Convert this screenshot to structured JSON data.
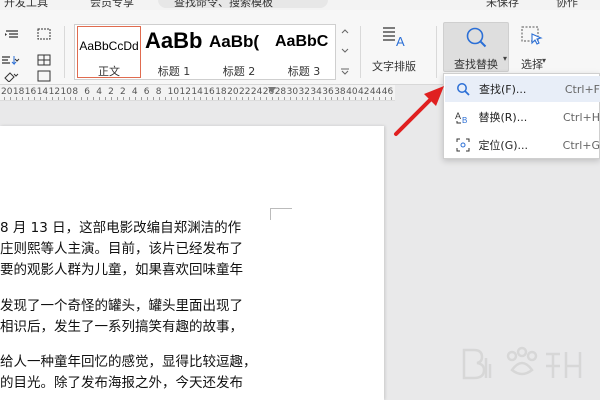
{
  "topbar": {
    "dev_tools": "开发工具",
    "member": "会员专享",
    "search_hint": "查找命令、搜索模板",
    "unsaved": "未保存",
    "collab": "协作"
  },
  "styles": [
    {
      "sample": "AaBbCcDd",
      "label": "正文"
    },
    {
      "sample": "AaBb",
      "label": "标题 1"
    },
    {
      "sample": "AaBb(",
      "label": "标题 2"
    },
    {
      "sample": "AaBbC",
      "label": "标题 3"
    }
  ],
  "ribbon": {
    "text_layout": "文字排版",
    "find_replace": "查找替换",
    "select": "选择"
  },
  "ruler_numbers": [
    "20",
    "18",
    "16",
    "14",
    "12",
    "10",
    "8",
    "6",
    "4",
    "2",
    "2",
    "4",
    "6",
    "8",
    "10",
    "12",
    "14",
    "16",
    "18",
    "20",
    "22",
    "24",
    "26",
    "28",
    "30",
    "32",
    "34",
    "36",
    "38",
    "40",
    "42",
    "44",
    "46"
  ],
  "document": {
    "p1": [
      "8 月 13 日，这部电影改编自郑渊洁的作",
      "庄则熙等人主演。目前，该片已经发布了",
      "要的观影人群为儿童，如果喜欢回味童年"
    ],
    "p2": [
      "发现了一个奇怪的罐头，罐头里面出现了",
      "相识后，发生了一系列搞笑有趣的故事，"
    ],
    "p3": [
      "给人一种童年回忆的感觉，显得比较逗趣，",
      "的目光。除了发布海报之外，今天还发布",
      "……"
    ]
  },
  "menu": [
    {
      "label": "查找(F)...",
      "shortcut": "Ctrl+F",
      "icon": "search-icon"
    },
    {
      "label": "替换(R)...",
      "shortcut": "Ctrl+H",
      "icon": "replace-icon"
    },
    {
      "label": "定位(G)...",
      "shortcut": "Ctrl+G",
      "icon": "goto-icon"
    }
  ],
  "colors": {
    "accent_red": "#e02020",
    "active_border": "#e06b4f",
    "icon_blue": "#2b6fd6"
  }
}
